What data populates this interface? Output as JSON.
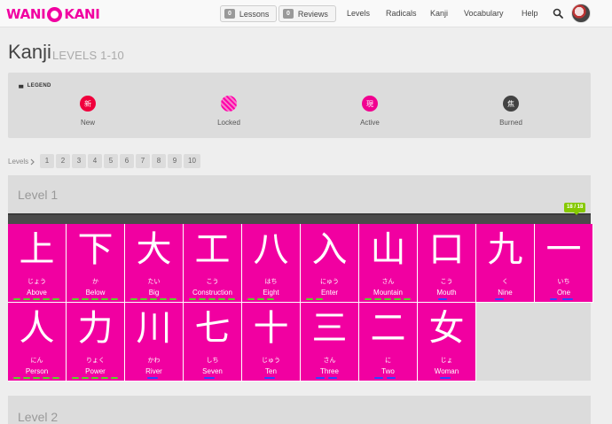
{
  "header": {
    "logo_left": "WANI",
    "logo_right": "KANI",
    "lessons": {
      "count": "0",
      "label": "Lessons"
    },
    "reviews": {
      "count": "0",
      "label": "Reviews"
    },
    "nav": [
      "Levels",
      "Radicals",
      "Kanji",
      "Vocabulary",
      "Help"
    ]
  },
  "page": {
    "title": "Kanji",
    "subtitle": "LEVELS 1-10"
  },
  "legend": {
    "title": "LEGEND",
    "items": [
      {
        "label": "New",
        "glyph": "新",
        "color": "#f0003c"
      },
      {
        "label": "Locked",
        "glyph": "鎖",
        "color": "#f77cc9"
      },
      {
        "label": "Active",
        "glyph": "現",
        "color": "#f10090"
      },
      {
        "label": "Burned",
        "glyph": "焦",
        "color": "#434343"
      }
    ]
  },
  "levels": {
    "label": "Levels",
    "numbers": [
      "1",
      "2",
      "3",
      "4",
      "5",
      "6",
      "7",
      "8",
      "9",
      "10"
    ]
  },
  "level1": {
    "title": "Level 1",
    "progress": "18 / 18",
    "kanji": [
      {
        "char": "上",
        "reading": "じょう",
        "meaning": "Above"
      },
      {
        "char": "下",
        "reading": "か",
        "meaning": "Below"
      },
      {
        "char": "大",
        "reading": "たい",
        "meaning": "Big"
      },
      {
        "char": "工",
        "reading": "こう",
        "meaning": "Construction"
      },
      {
        "char": "八",
        "reading": "はち",
        "meaning": "Eight"
      },
      {
        "char": "入",
        "reading": "にゅう",
        "meaning": "Enter"
      },
      {
        "char": "山",
        "reading": "さん",
        "meaning": "Mountain"
      },
      {
        "char": "口",
        "reading": "こう",
        "meaning": "Mouth"
      },
      {
        "char": "九",
        "reading": "く",
        "meaning": "Nine"
      },
      {
        "char": "一",
        "reading": "いち",
        "meaning": "One"
      },
      {
        "char": "人",
        "reading": "にん",
        "meaning": "Person"
      },
      {
        "char": "力",
        "reading": "りょく",
        "meaning": "Power"
      },
      {
        "char": "川",
        "reading": "かわ",
        "meaning": "River"
      },
      {
        "char": "七",
        "reading": "しち",
        "meaning": "Seven"
      },
      {
        "char": "十",
        "reading": "じゅう",
        "meaning": "Ten"
      },
      {
        "char": "三",
        "reading": "さん",
        "meaning": "Three"
      },
      {
        "char": "二",
        "reading": "に",
        "meaning": "Two"
      },
      {
        "char": "女",
        "reading": "じょ",
        "meaning": "Woman"
      }
    ]
  },
  "level2": {
    "title": "Level 2"
  },
  "colors": {
    "brand": "#f100a1",
    "progress_badge": "#86c900",
    "panel": "#dcdcdc"
  }
}
